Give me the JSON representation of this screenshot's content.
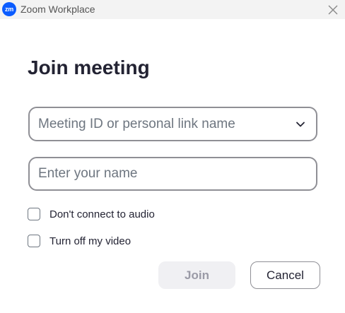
{
  "window": {
    "logo_text": "zm",
    "title": "Zoom Workplace",
    "close_icon": "close-icon"
  },
  "dialog": {
    "heading": "Join meeting",
    "meeting_field": {
      "placeholder": "Meeting ID or personal link name",
      "value": "",
      "dropdown_icon": "chevron-down-icon"
    },
    "name_field": {
      "placeholder": "Enter your name",
      "value": ""
    },
    "options": [
      {
        "label": "Don't connect to audio",
        "checked": false
      },
      {
        "label": "Turn off my video",
        "checked": false
      }
    ],
    "buttons": {
      "join_label": "Join",
      "join_enabled": false,
      "cancel_label": "Cancel"
    }
  },
  "colors": {
    "brand_blue": "#0b5cff",
    "text_primary": "#232333",
    "titlebar_bg": "#f3f3f3",
    "field_border": "#8f8f95",
    "disabled_button_bg": "#f0f0f3",
    "disabled_button_text": "#9a9aa6"
  }
}
